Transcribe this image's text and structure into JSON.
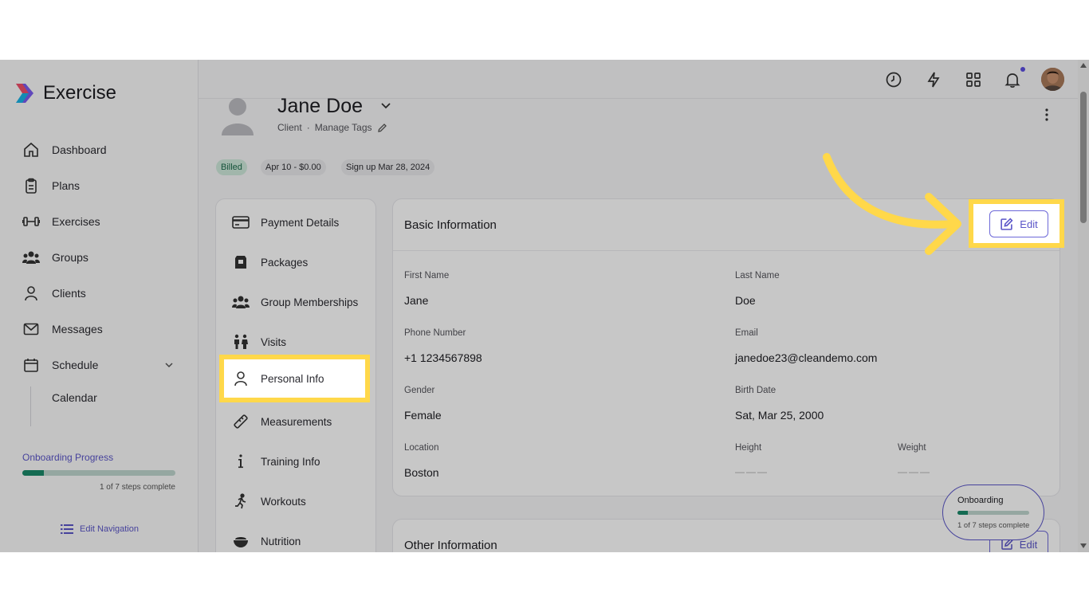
{
  "app": {
    "name": "Exercise"
  },
  "sidebar": {
    "items": [
      {
        "label": "Dashboard",
        "icon": "home-icon"
      },
      {
        "label": "Plans",
        "icon": "clipboard-icon"
      },
      {
        "label": "Exercises",
        "icon": "dumbbell-icon"
      },
      {
        "label": "Groups",
        "icon": "group-icon"
      },
      {
        "label": "Clients",
        "icon": "user-icon"
      },
      {
        "label": "Messages",
        "icon": "mail-icon"
      },
      {
        "label": "Schedule",
        "icon": "calendar-icon"
      }
    ],
    "sub_item": "Calendar",
    "onboarding": {
      "title": "Onboarding Progress",
      "steps": "1 of 7 steps complete",
      "progress": 0.14
    },
    "edit_navigation": "Edit Navigation"
  },
  "profile": {
    "name": "Jane Doe",
    "role": "Client",
    "separator": "·",
    "manage_tags": "Manage Tags",
    "pills": [
      "Billed",
      "Apr 10 - $0.00",
      "Sign up Mar 28, 2024"
    ]
  },
  "menu": {
    "items": [
      {
        "label": "Payment Details",
        "icon": "credit-card-icon"
      },
      {
        "label": "Packages",
        "icon": "package-icon"
      },
      {
        "label": "Group Memberships",
        "icon": "group-icon"
      },
      {
        "label": "Visits",
        "icon": "visits-icon"
      },
      {
        "label": "Personal Info",
        "icon": "user-icon"
      },
      {
        "label": "Measurements",
        "icon": "ruler-icon"
      },
      {
        "label": "Training Info",
        "icon": "info-icon"
      },
      {
        "label": "Workouts",
        "icon": "running-icon"
      },
      {
        "label": "Nutrition",
        "icon": "bowl-icon"
      }
    ],
    "active_index": 4
  },
  "basic_info": {
    "title": "Basic Information",
    "edit_label": "Edit",
    "first_name_label": "First Name",
    "first_name": "Jane",
    "last_name_label": "Last Name",
    "last_name": "Doe",
    "phone_label": "Phone Number",
    "phone": "+1 1234567898",
    "email_label": "Email",
    "email": "janedoe23@cleandemo.com",
    "gender_label": "Gender",
    "gender": "Female",
    "birth_label": "Birth Date",
    "birth": "Sat, Mar 25, 2000",
    "location_label": "Location",
    "location": "Boston",
    "height_label": "Height",
    "height": "———",
    "weight_label": "Weight",
    "weight": "———"
  },
  "other_info": {
    "title": "Other Information",
    "edit_label": "Edit"
  },
  "bubble": {
    "title": "Onboarding",
    "steps": "1 of 7 steps complete",
    "progress": 0.14
  },
  "colors": {
    "accent": "#5a55c8",
    "highlight": "#ffd84a",
    "success": "#1a8a6a"
  }
}
